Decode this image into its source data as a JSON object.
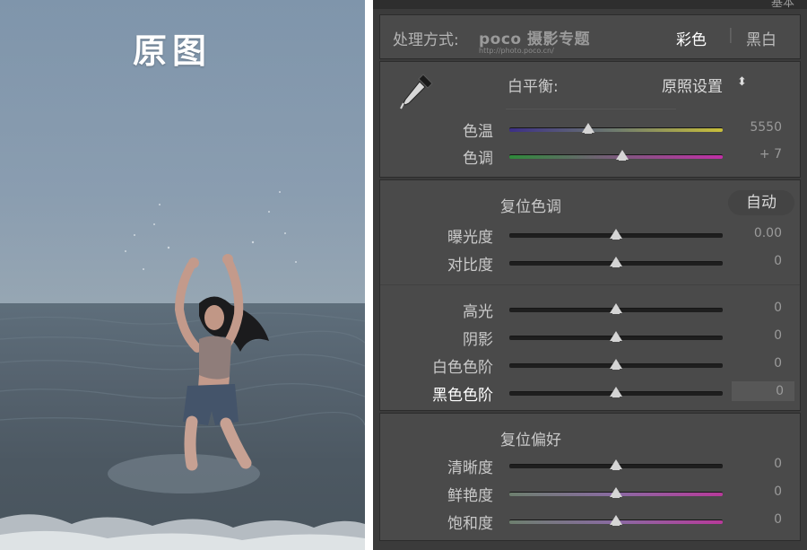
{
  "photo": {
    "title": "原图"
  },
  "panel": {
    "top_cut_text": "基本",
    "process": {
      "label": "处理方式:",
      "logo": "poco 摄影专题",
      "logo_url": "http://photo.poco.cn/",
      "color": "彩色",
      "separator": "|",
      "bw": "黑白"
    },
    "white_balance": {
      "label": "白平衡:",
      "preset": "原照设置",
      "preset_arrow": "⬍",
      "sliders": [
        {
          "label": "色温",
          "value": "5550",
          "level": 0.37
        },
        {
          "label": "色调",
          "value": "+ 7",
          "level": 0.53
        }
      ]
    },
    "tone": {
      "reset_label": "复位色调",
      "auto_label": "自动",
      "sliders": [
        {
          "label": "曝光度",
          "value": "0.00",
          "level": 0.5
        },
        {
          "label": "对比度",
          "value": "0",
          "level": 0.5
        },
        {
          "label": "高光",
          "value": "0",
          "level": 0.5
        },
        {
          "label": "阴影",
          "value": "0",
          "level": 0.5
        },
        {
          "label": "白色色阶",
          "value": "0",
          "level": 0.5
        },
        {
          "label": "黑色色阶",
          "value": "0",
          "level": 0.5
        }
      ]
    },
    "presence": {
      "reset_label": "复位偏好",
      "sliders": [
        {
          "label": "清晰度",
          "value": "0",
          "level": 0.5
        },
        {
          "label": "鲜艳度",
          "value": "0",
          "level": 0.5
        },
        {
          "label": "饱和度",
          "value": "0",
          "level": 0.5
        }
      ]
    }
  },
  "colors": {
    "temp_gradient": [
      "#3c2f86",
      "#6f7c6e",
      "#c9bf3a"
    ],
    "tint_gradient": [
      "#2e8a3a",
      "#7b5a7c",
      "#c02fa6"
    ],
    "sat_gradient": [
      "#6d7f6e",
      "#8a6aa2",
      "#b73a9a"
    ]
  }
}
